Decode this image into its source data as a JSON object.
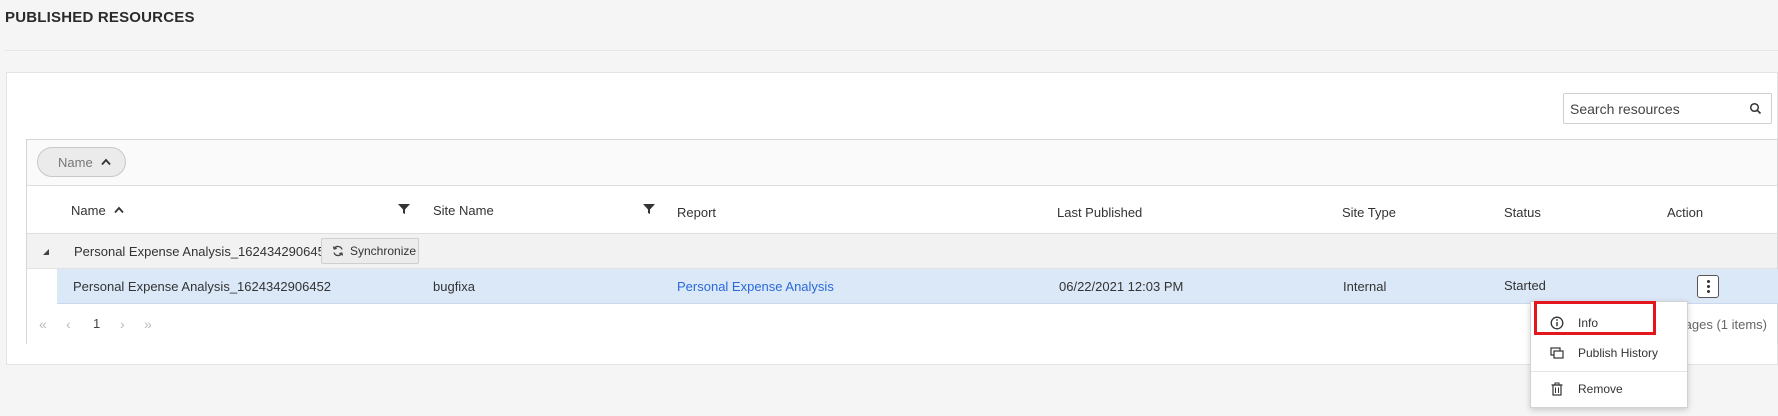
{
  "page": {
    "title": "PUBLISHED RESOURCES"
  },
  "search": {
    "placeholder": "Search resources"
  },
  "grouping": {
    "chip_label": "Name"
  },
  "columns": {
    "name": "Name",
    "site_name": "Site Name",
    "report": "Report",
    "last_published": "Last Published",
    "site_type": "Site Type",
    "status": "Status",
    "action": "Action"
  },
  "group": {
    "name": "Personal Expense Analysis_1624342906452",
    "sync_label": "Synchronize"
  },
  "rows": [
    {
      "name": "Personal Expense Analysis_1624342906452",
      "site_name": "bugfixa",
      "report": "Personal Expense Analysis",
      "last_published": "06/22/2021 12:03 PM",
      "site_type": "Internal",
      "status": "Started"
    }
  ],
  "pager": {
    "current_page": "1",
    "info": "pages (1 items)"
  },
  "context_menu": {
    "items": [
      {
        "label": "Info",
        "icon": "info-icon"
      },
      {
        "label": "Publish History",
        "icon": "publish-history-icon"
      },
      {
        "label": "Remove",
        "icon": "trash-icon"
      }
    ]
  },
  "colors": {
    "selected_row": "#dbe8f8",
    "link": "#2a6ad8",
    "highlight": "#e3161e"
  }
}
